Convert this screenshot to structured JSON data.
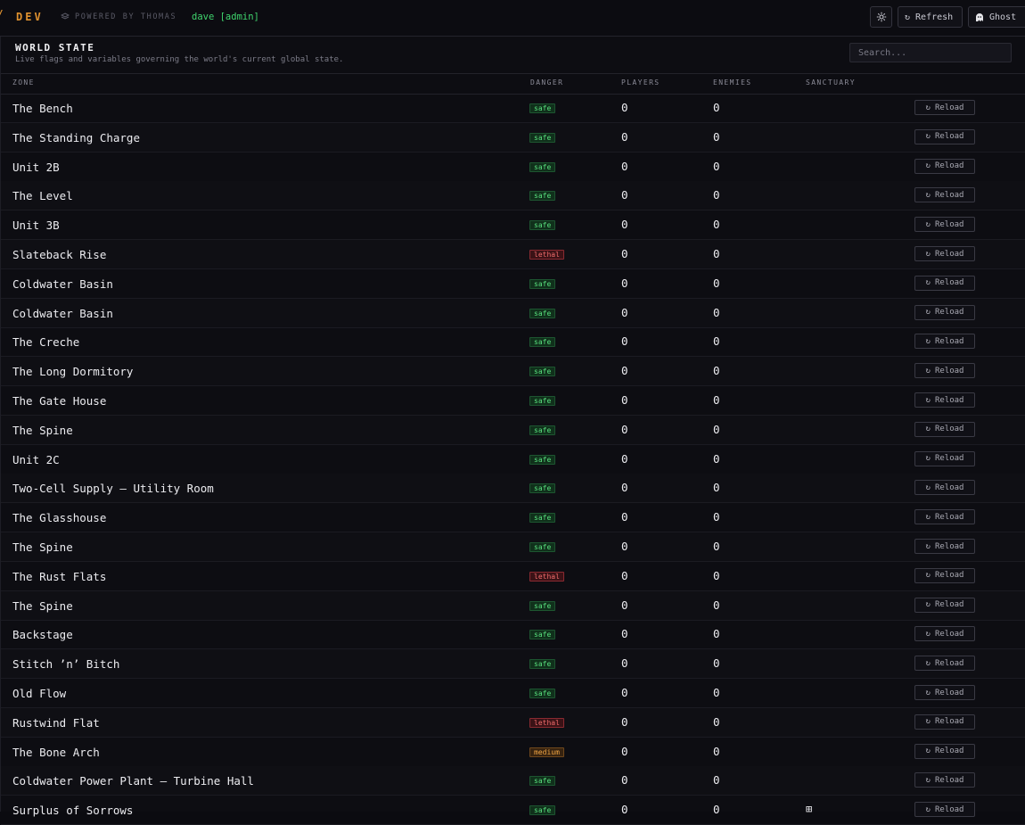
{
  "header": {
    "brand_mark": "/",
    "brand": "DEV",
    "powered_by": "POWERED BY THOMAS",
    "user": "dave [admin]",
    "settings_icon": "gear-icon",
    "refresh_label": "Refresh",
    "ghost_label": "Ghost"
  },
  "panel": {
    "title": "WORLD STATE",
    "subtitle": "Live flags and variables governing the world's current global state.",
    "search_placeholder": "Search..."
  },
  "columns": {
    "zone": "ZONE",
    "danger": "DANGER",
    "players": "PLAYERS",
    "enemies": "ENEMIES",
    "sanctuary": "SANCTUARY"
  },
  "reload_label": "Reload",
  "colors": {
    "accent": "#e0922f",
    "user": "#3fd46d",
    "safe": "#59e07e",
    "lethal": "#ef6b6b",
    "medium": "#f0a544"
  },
  "rows": [
    {
      "zone": "The Bench",
      "danger": "safe",
      "players": "0",
      "enemies": "0",
      "sanctuary": ""
    },
    {
      "zone": "The Standing Charge",
      "danger": "safe",
      "players": "0",
      "enemies": "0",
      "sanctuary": ""
    },
    {
      "zone": "Unit 2B",
      "danger": "safe",
      "players": "0",
      "enemies": "0",
      "sanctuary": ""
    },
    {
      "zone": "The Level",
      "danger": "safe",
      "players": "0",
      "enemies": "0",
      "sanctuary": ""
    },
    {
      "zone": "Unit 3B",
      "danger": "safe",
      "players": "0",
      "enemies": "0",
      "sanctuary": ""
    },
    {
      "zone": "Slateback Rise",
      "danger": "lethal",
      "players": "0",
      "enemies": "0",
      "sanctuary": ""
    },
    {
      "zone": "Coldwater Basin",
      "danger": "safe",
      "players": "0",
      "enemies": "0",
      "sanctuary": ""
    },
    {
      "zone": "Coldwater Basin",
      "danger": "safe",
      "players": "0",
      "enemies": "0",
      "sanctuary": ""
    },
    {
      "zone": "The Creche",
      "danger": "safe",
      "players": "0",
      "enemies": "0",
      "sanctuary": ""
    },
    {
      "zone": "The Long Dormitory",
      "danger": "safe",
      "players": "0",
      "enemies": "0",
      "sanctuary": ""
    },
    {
      "zone": "The Gate House",
      "danger": "safe",
      "players": "0",
      "enemies": "0",
      "sanctuary": ""
    },
    {
      "zone": "The Spine",
      "danger": "safe",
      "players": "0",
      "enemies": "0",
      "sanctuary": ""
    },
    {
      "zone": "Unit 2C",
      "danger": "safe",
      "players": "0",
      "enemies": "0",
      "sanctuary": ""
    },
    {
      "zone": "Two-Cell Supply — Utility Room",
      "danger": "safe",
      "players": "0",
      "enemies": "0",
      "sanctuary": ""
    },
    {
      "zone": "The Glasshouse",
      "danger": "safe",
      "players": "0",
      "enemies": "0",
      "sanctuary": ""
    },
    {
      "zone": "The Spine",
      "danger": "safe",
      "players": "0",
      "enemies": "0",
      "sanctuary": ""
    },
    {
      "zone": "The Rust Flats",
      "danger": "lethal",
      "players": "0",
      "enemies": "0",
      "sanctuary": ""
    },
    {
      "zone": "The Spine",
      "danger": "safe",
      "players": "0",
      "enemies": "0",
      "sanctuary": ""
    },
    {
      "zone": "Backstage",
      "danger": "safe",
      "players": "0",
      "enemies": "0",
      "sanctuary": ""
    },
    {
      "zone": "Stitch ’n’ Bitch",
      "danger": "safe",
      "players": "0",
      "enemies": "0",
      "sanctuary": ""
    },
    {
      "zone": "Old Flow",
      "danger": "safe",
      "players": "0",
      "enemies": "0",
      "sanctuary": ""
    },
    {
      "zone": "Rustwind Flat",
      "danger": "lethal",
      "players": "0",
      "enemies": "0",
      "sanctuary": ""
    },
    {
      "zone": "The Bone Arch",
      "danger": "medium",
      "players": "0",
      "enemies": "0",
      "sanctuary": ""
    },
    {
      "zone": "Coldwater Power Plant — Turbine Hall",
      "danger": "safe",
      "players": "0",
      "enemies": "0",
      "sanctuary": ""
    },
    {
      "zone": "Surplus of Sorrows",
      "danger": "safe",
      "players": "0",
      "enemies": "0",
      "sanctuary": "⊞"
    }
  ]
}
